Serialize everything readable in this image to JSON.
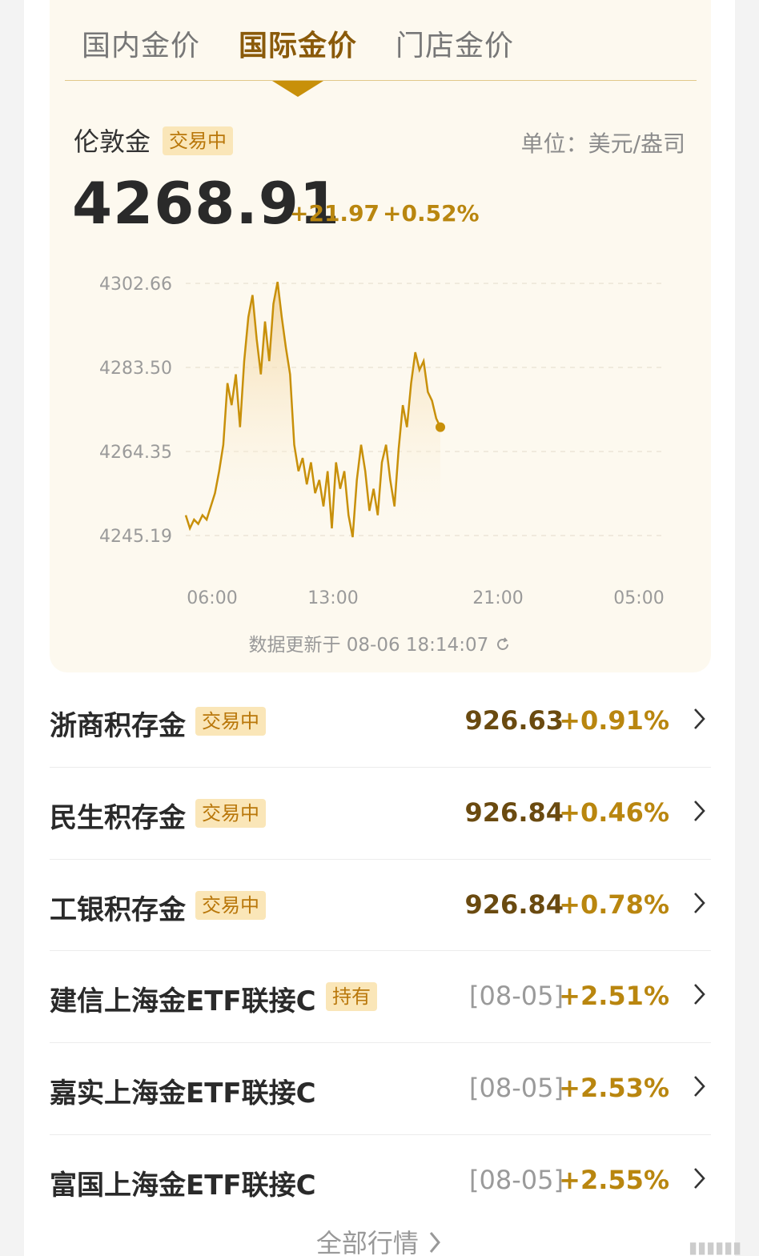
{
  "tabs": [
    {
      "label": "国内金价",
      "active": false
    },
    {
      "label": "国际金价",
      "active": true
    },
    {
      "label": "门店金价",
      "active": false
    }
  ],
  "market": {
    "name": "伦敦金",
    "status": "交易中",
    "unit": "单位：美元/盎司",
    "price": "4268.91",
    "change": "+21.97",
    "change_pct": "+0.52%"
  },
  "chart_data": {
    "type": "area",
    "y_ticks": [
      "4302.66",
      "4283.50",
      "4264.35",
      "4245.19"
    ],
    "x_ticks": [
      "06:00",
      "13:00",
      "21:00",
      "05:00"
    ],
    "ylim": [
      4245.19,
      4302.66
    ],
    "line_color": "#c8900a",
    "series": [
      {
        "values": [
          4250,
          4247,
          4249,
          4248,
          4250,
          4249,
          4252,
          4255,
          4260,
          4266,
          4280,
          4275,
          4282,
          4270,
          4285,
          4295,
          4300,
          4290,
          4282,
          4294,
          4285,
          4298,
          4303,
          4295,
          4288,
          4282,
          4266,
          4260,
          4263,
          4257,
          4262,
          4255,
          4258,
          4252,
          4260,
          4247,
          4262,
          4256,
          4260,
          4250,
          4245,
          4258,
          4266,
          4260,
          4251,
          4256,
          4250,
          4262,
          4266,
          4258,
          4252,
          4265,
          4275,
          4270,
          4280,
          4287,
          4283,
          4285,
          4278,
          4276,
          4272,
          4270
        ]
      }
    ],
    "last_point": 4270
  },
  "update_text": "数据更新于 08-06 18:14:07",
  "items": [
    {
      "name": "浙商积存金",
      "badge": "交易中",
      "value": "926.63",
      "pct": "+0.91%",
      "is_date": false
    },
    {
      "name": "民生积存金",
      "badge": "交易中",
      "value": "926.84",
      "pct": "+0.46%",
      "is_date": false
    },
    {
      "name": "工银积存金",
      "badge": "交易中",
      "value": "926.84",
      "pct": "+0.78%",
      "is_date": false
    },
    {
      "name": "建信上海金ETF联接C",
      "badge": "持有",
      "value": "[08-05]",
      "pct": "+2.51%",
      "is_date": true
    },
    {
      "name": "嘉实上海金ETF联接C",
      "badge": "",
      "value": "[08-05]",
      "pct": "+2.53%",
      "is_date": true
    },
    {
      "name": "富国上海金ETF联接C",
      "badge": "",
      "value": "[08-05]",
      "pct": "+2.55%",
      "is_date": true
    }
  ],
  "more_label": "全部行情"
}
